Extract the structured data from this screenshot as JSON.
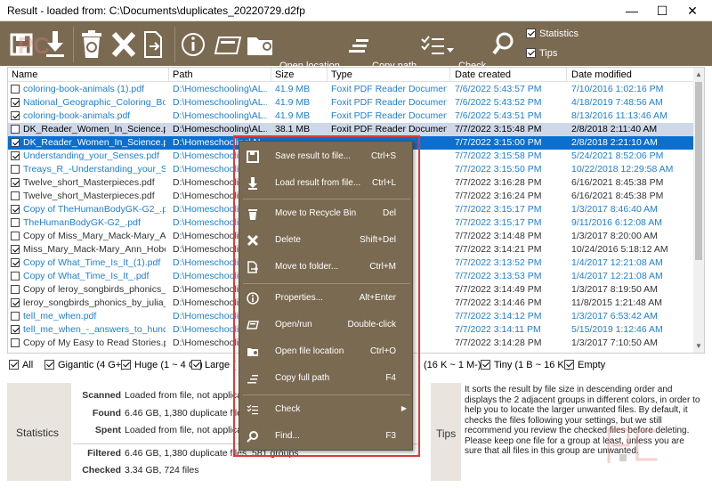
{
  "window": {
    "title": "Result - loaded from: C:\\Documents\\duplicates_20220729.d2fp",
    "minimize_glyph": "—",
    "maximize_glyph": "☐",
    "close_glyph": "✕"
  },
  "toolbar": {
    "open_location_label": "Open location",
    "copy_path_label": "Copy path",
    "check_label": "Check",
    "statistics_label": "Statistics",
    "tips_label": "Tips",
    "statistics_checked": true,
    "tips_checked": true
  },
  "columns": {
    "name": "Name",
    "path": "Path",
    "size": "Size",
    "type": "Type",
    "created": "Date created",
    "modified": "Date modified"
  },
  "rows": [
    {
      "checked": false,
      "name": "coloring-book-animals (1).pdf",
      "path": "D:\\Homeschooling\\AL...",
      "size": "41.9 MB",
      "type": "Foxit PDF Reader Document",
      "created": "7/6/2022 5:43:57 PM",
      "modified": "7/10/2016 1:02:16 PM",
      "color": "blue",
      "sel": ""
    },
    {
      "checked": true,
      "name": "National_Geographic_Coloring_Book...",
      "path": "D:\\Homeschooling\\AL...",
      "size": "41.9 MB",
      "type": "Foxit PDF Reader Document",
      "created": "7/6/2022 5:43:52 PM",
      "modified": "4/18/2019 7:48:56 AM",
      "color": "blue",
      "sel": ""
    },
    {
      "checked": true,
      "name": "coloring-book-animals.pdf",
      "path": "D:\\Homeschooling\\AL...",
      "size": "41.9 MB",
      "type": "Foxit PDF Reader Document",
      "created": "7/6/2022 5:43:51 PM",
      "modified": "8/13/2016 11:13:46 AM",
      "color": "blue",
      "sel": ""
    },
    {
      "checked": false,
      "name": "DK_Reader_Women_In_Science.pdf",
      "path": "D:\\Homeschooling\\AL...",
      "size": "38.1 MB",
      "type": "Foxit PDF Reader Document",
      "created": "7/7/2022 3:15:48 PM",
      "modified": "2/8/2018 2:11:40 AM",
      "color": "dark",
      "sel": "sel1"
    },
    {
      "checked": true,
      "name": "DK_Reader_Women_In_Science.pdf",
      "path": "D:\\Homeschooling\\AL...",
      "size": "",
      "type": "",
      "created": "7/7/2022 3:15:00 PM",
      "modified": "2/8/2018 2:21:10 AM",
      "color": "dark",
      "sel": "sel2"
    },
    {
      "checked": true,
      "name": "Understanding_your_Senses.pdf",
      "path": "D:\\Homeschooling\\",
      "size": "",
      "type": "",
      "created": "7/7/2022 3:15:58 PM",
      "modified": "5/24/2021 8:52:06 PM",
      "color": "blue",
      "sel": ""
    },
    {
      "checked": false,
      "name": "Treays_R_-Understanding_your_Sens...",
      "path": "D:\\Homeschooling\\",
      "size": "",
      "type": "",
      "created": "7/7/2022 3:15:50 PM",
      "modified": "10/22/2018 12:29:58 AM",
      "color": "blue",
      "sel": ""
    },
    {
      "checked": true,
      "name": "Twelve_short_Masterpieces.pdf",
      "path": "D:\\Homeschooling\\",
      "size": "",
      "type": "",
      "created": "7/7/2022 3:16:28 PM",
      "modified": "6/16/2021 8:45:38 PM",
      "color": "dark",
      "sel": ""
    },
    {
      "checked": false,
      "name": "Twelve_short_Masterpieces.pdf",
      "path": "D:\\Homeschooling\\",
      "size": "",
      "type": "",
      "created": "7/7/2022 3:16:24 PM",
      "modified": "6/16/2021 8:45:38 PM",
      "color": "dark",
      "sel": ""
    },
    {
      "checked": true,
      "name": "Copy of TheHumanBodyGK-G2_.pdf",
      "path": "D:\\Homeschooling\\",
      "size": "",
      "type": "",
      "created": "7/7/2022 3:15:17 PM",
      "modified": "1/3/2017 8:46:40 AM",
      "color": "blue",
      "sel": ""
    },
    {
      "checked": false,
      "name": "TheHumanBodyGK-G2_.pdf",
      "path": "D:\\Homeschooling\\",
      "size": "",
      "type": "",
      "created": "7/7/2022 3:15:17 PM",
      "modified": "9/11/2016 6:12:08 AM",
      "color": "blue",
      "sel": ""
    },
    {
      "checked": false,
      "name": "Copy of Miss_Mary_Mack-Mary_Ann...",
      "path": "D:\\Homeschooling\\",
      "size": "",
      "type": "",
      "created": "7/7/2022 3:14:48 PM",
      "modified": "1/3/2017 8:20:00 AM",
      "color": "dark",
      "sel": ""
    },
    {
      "checked": true,
      "name": "Miss_Mary_Mack-Mary_Ann_Hober...",
      "path": "D:\\Homeschooling\\",
      "size": "",
      "type": "",
      "created": "7/7/2022 3:14:21 PM",
      "modified": "10/24/2016 5:18:12 AM",
      "color": "dark",
      "sel": ""
    },
    {
      "checked": true,
      "name": "Copy of What_Time_Is_It_(1).pdf",
      "path": "D:\\Homeschooling\\",
      "size": "",
      "type": "",
      "created": "7/7/2022 3:13:52 PM",
      "modified": "1/4/2017 12:21:08 AM",
      "color": "blue",
      "sel": ""
    },
    {
      "checked": false,
      "name": "Copy of What_Time_Is_It_.pdf",
      "path": "D:\\Homeschooling\\",
      "size": "",
      "type": "",
      "created": "7/7/2022 3:13:53 PM",
      "modified": "1/4/2017 12:21:08 AM",
      "color": "blue",
      "sel": ""
    },
    {
      "checked": false,
      "name": "Copy of leroy_songbirds_phonics_by...",
      "path": "D:\\Homeschooling\\",
      "size": "",
      "type": "",
      "created": "7/7/2022 3:14:49 PM",
      "modified": "1/3/2017 8:19:50 AM",
      "color": "dark",
      "sel": ""
    },
    {
      "checked": true,
      "name": "leroy_songbirds_phonics_by_julia_do...",
      "path": "D:\\Homeschooling\\",
      "size": "",
      "type": "",
      "created": "7/7/2022 3:14:46 PM",
      "modified": "11/8/2015 1:21:48 AM",
      "color": "dark",
      "sel": ""
    },
    {
      "checked": false,
      "name": "tell_me_when.pdf",
      "path": "D:\\Homeschooling\\",
      "size": "",
      "type": "",
      "created": "7/7/2022 3:14:12 PM",
      "modified": "1/3/2017 6:53:42 AM",
      "color": "blue",
      "sel": ""
    },
    {
      "checked": true,
      "name": "tell_me_when_-_answers_to_hundred...",
      "path": "D:\\Homeschooling\\",
      "size": "",
      "type": "",
      "created": "7/7/2022 3:14:11 PM",
      "modified": "5/15/2019 1:12:46 AM",
      "color": "blue",
      "sel": ""
    },
    {
      "checked": false,
      "name": "Copy of My Easy to Read Stories.pdf",
      "path": "D:\\Homeschooling\\",
      "size": "",
      "type": "",
      "created": "7/7/2022 3:14:28 PM",
      "modified": "1/3/2017 7:10:50 AM",
      "color": "dark",
      "sel": ""
    }
  ],
  "partial_row": {
    "path": "D:\\Homeschooling\\AL",
    "size": "38.1 MB",
    "type": "Foxit PDF Reader Document"
  },
  "filters": {
    "all": "All",
    "gigantic": "Gigantic (4 G+)",
    "huge": "Huge (1 ~ 4 G-)",
    "large": "Large (",
    "small": "(16 K ~ 1 M-)",
    "tiny": "Tiny (1 B ~ 16 K-)",
    "empty": "Empty"
  },
  "statistics": {
    "title": "Statistics",
    "scanned_label": "Scanned",
    "scanned_value": "Loaded from file, not applical",
    "found_label": "Found",
    "found_value": "6.46 GB, 1,380 duplicate files, ",
    "spent_label": "Spent",
    "spent_value": "Loaded from file, not applical",
    "filtered_label": "Filtered",
    "filtered_value": "6.46 GB, 1,380 duplicate files, 581 groups",
    "checked_label": "Checked",
    "checked_value": "3.34 GB, 724 files"
  },
  "tips": {
    "title": "Tips",
    "text": "It sorts the result by file size in descending order and displays the 2 adjacent groups in different colors, in order to help you to locate the larger unwanted files. By default, it checks the files following your settings, but we still recommend you review the checked files before deleting. Please keep one file for a group at least, unless you are sure that all files in this group are unwanted."
  },
  "context_menu": {
    "save_label": "Save result to file...",
    "save_shortcut": "Ctrl+S",
    "load_label": "Load result from file...",
    "load_shortcut": "Ctrl+L",
    "recycle_label": "Move to Recycle Bin",
    "recycle_shortcut": "Del",
    "delete_label": "Delete",
    "delete_shortcut": "Shift+Del",
    "move_label": "Move to folder...",
    "move_shortcut": "Ctrl+M",
    "properties_label": "Properties...",
    "properties_shortcut": "Alt+Enter",
    "open_label": "Open/run",
    "open_shortcut": "Double-click",
    "openloc_label": "Open file location",
    "openloc_shortcut": "Ctrl+O",
    "copypath_label": "Copy full path",
    "copypath_shortcut": "F4",
    "check_label": "Check",
    "find_label": "Find...",
    "find_shortcut": "F3"
  },
  "watermark_text": "PC"
}
